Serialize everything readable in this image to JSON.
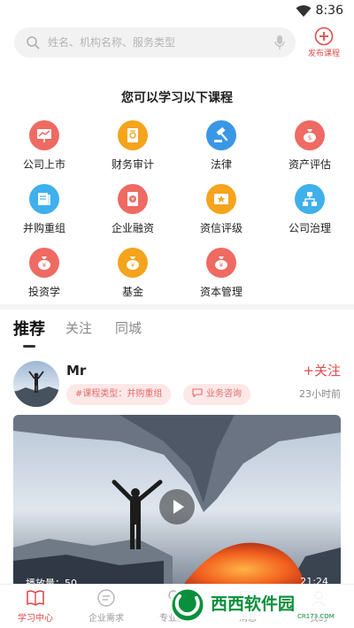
{
  "status_bar": {
    "time": "8:36"
  },
  "search": {
    "placeholder": "姓名、机构名称、服务类型"
  },
  "publish": {
    "label": "发布课程"
  },
  "section_title": "您可以学习以下课程",
  "categories": [
    {
      "label": "公司上市",
      "color": "#ee6a62",
      "icon": "chart-board-icon"
    },
    {
      "label": "财务审计",
      "color": "#f5a41c",
      "icon": "audit-document-icon"
    },
    {
      "label": "法律",
      "color": "#3a97e6",
      "icon": "gavel-icon"
    },
    {
      "label": "资产评估",
      "color": "#ee6a62",
      "icon": "money-bag-icon"
    },
    {
      "label": "并购重组",
      "color": "#3fb0ec",
      "icon": "book-icon"
    },
    {
      "label": "企业融资",
      "color": "#ee6a62",
      "icon": "finance-coin-icon"
    },
    {
      "label": "资信评级",
      "color": "#f5a41c",
      "icon": "rating-card-icon"
    },
    {
      "label": "公司治理",
      "color": "#3fb0ec",
      "icon": "org-chart-icon"
    },
    {
      "label": "投资学",
      "color": "#ee6a62",
      "icon": "investment-bag-icon"
    },
    {
      "label": "基金",
      "color": "#f5a41c",
      "icon": "fund-bag-icon"
    },
    {
      "label": "资本管理",
      "color": "#ee6a62",
      "icon": "capital-bag-icon"
    }
  ],
  "tabs": [
    {
      "label": "推荐",
      "active": true
    },
    {
      "label": "关注",
      "active": false
    },
    {
      "label": "同城",
      "active": false
    }
  ],
  "post": {
    "username": "Mr",
    "tag_course": "#课程类型：并购重组",
    "tag_consult": "业务咨询",
    "follow_label": "+关注",
    "time_ago": "23小时前",
    "play_count": "播放量：50",
    "duration": "21:24"
  },
  "bottom_nav": [
    {
      "label": "学习中心",
      "active": true,
      "icon": "book-open-icon"
    },
    {
      "label": "企业需求",
      "active": false,
      "icon": "enterprise-icon"
    },
    {
      "label": "专业服务",
      "active": false,
      "icon": "heart-icon"
    },
    {
      "label": "消息",
      "active": false,
      "icon": "message-icon"
    },
    {
      "label": "我的",
      "active": false,
      "icon": "profile-icon"
    }
  ],
  "watermark": {
    "brand": "西西软件园",
    "site": "CR173.COM"
  },
  "colors": {
    "accent": "#e04b4b",
    "tag_bg": "#fde8e8"
  }
}
